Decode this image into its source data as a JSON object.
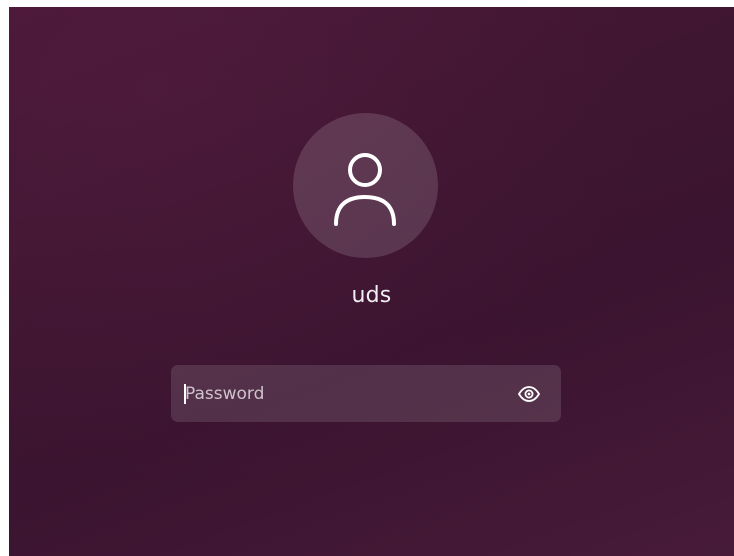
{
  "user": {
    "name": "uds",
    "avatar_icon": "user-icon"
  },
  "password": {
    "placeholder": "Password",
    "value": "",
    "reveal_icon": "eye-icon"
  },
  "colors": {
    "background": "#3f1631",
    "text": "#f2eef1",
    "field_fill": "rgba(255,255,255,0.12)",
    "avatar_fill": "rgba(255,255,255,0.14)"
  }
}
